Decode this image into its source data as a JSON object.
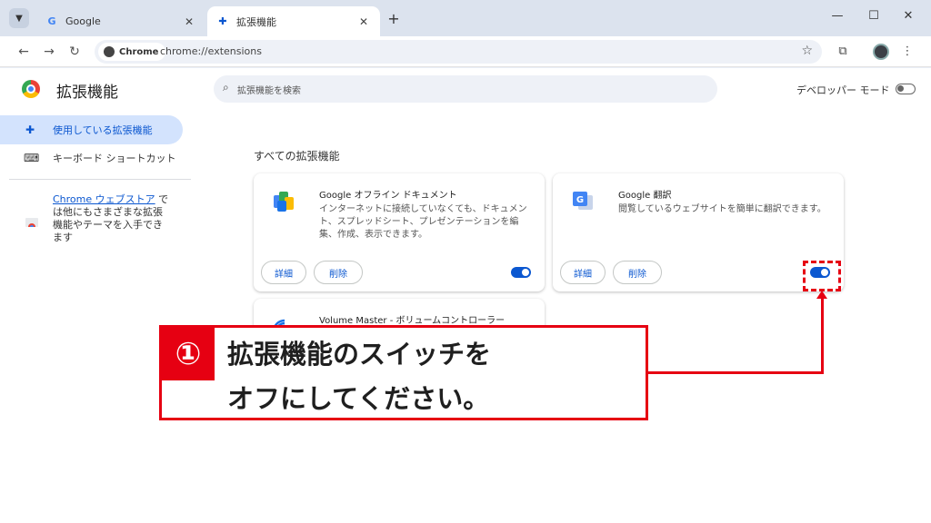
{
  "colors": {
    "accent": "#0b57d0",
    "annotation_red": "#e60012",
    "active_nav": "#d3e3fd"
  },
  "tabs": [
    {
      "label": "Google",
      "icon": "google-g-icon"
    },
    {
      "label": "拡張機能",
      "icon": "puzzle-icon"
    }
  ],
  "toolbar": {
    "chip_label": "Chrome",
    "url": "chrome://extensions"
  },
  "header": {
    "title": "拡張機能",
    "search_placeholder": "拡張機能を検索",
    "dev_mode_label": "デベロッパー モード",
    "dev_mode_on": false
  },
  "sidebar": {
    "items": [
      {
        "label": "使用している拡張機能",
        "icon": "puzzle-icon",
        "active": true
      },
      {
        "label": "キーボード ショートカット",
        "icon": "keyboard-icon",
        "active": false
      }
    ],
    "store_link": "Chrome ウェブストア",
    "store_text": " では他にもさまざまな拡張機能やテーマを入手できます"
  },
  "main": {
    "section_title": "すべての拡張機能",
    "extensions": [
      {
        "name": "Google オフライン ドキュメント",
        "description": "インターネットに接続していなくても、ドキュメント、スプレッドシート、プレゼンテーションを編集、作成、表示できます。",
        "details_label": "詳細",
        "remove_label": "削除",
        "enabled": true
      },
      {
        "name": "Google 翻訳",
        "description": "閲覧しているウェブサイトを簡単に翻訳できます。",
        "details_label": "詳細",
        "remove_label": "削除",
        "enabled": true
      },
      {
        "name": "Volume Master - ボリュームコントローラー",
        "description": "",
        "enabled": true
      }
    ]
  },
  "annotation": {
    "number": "①",
    "line1": "拡張機能のスイッチを",
    "line2": "オフにしてください。"
  }
}
